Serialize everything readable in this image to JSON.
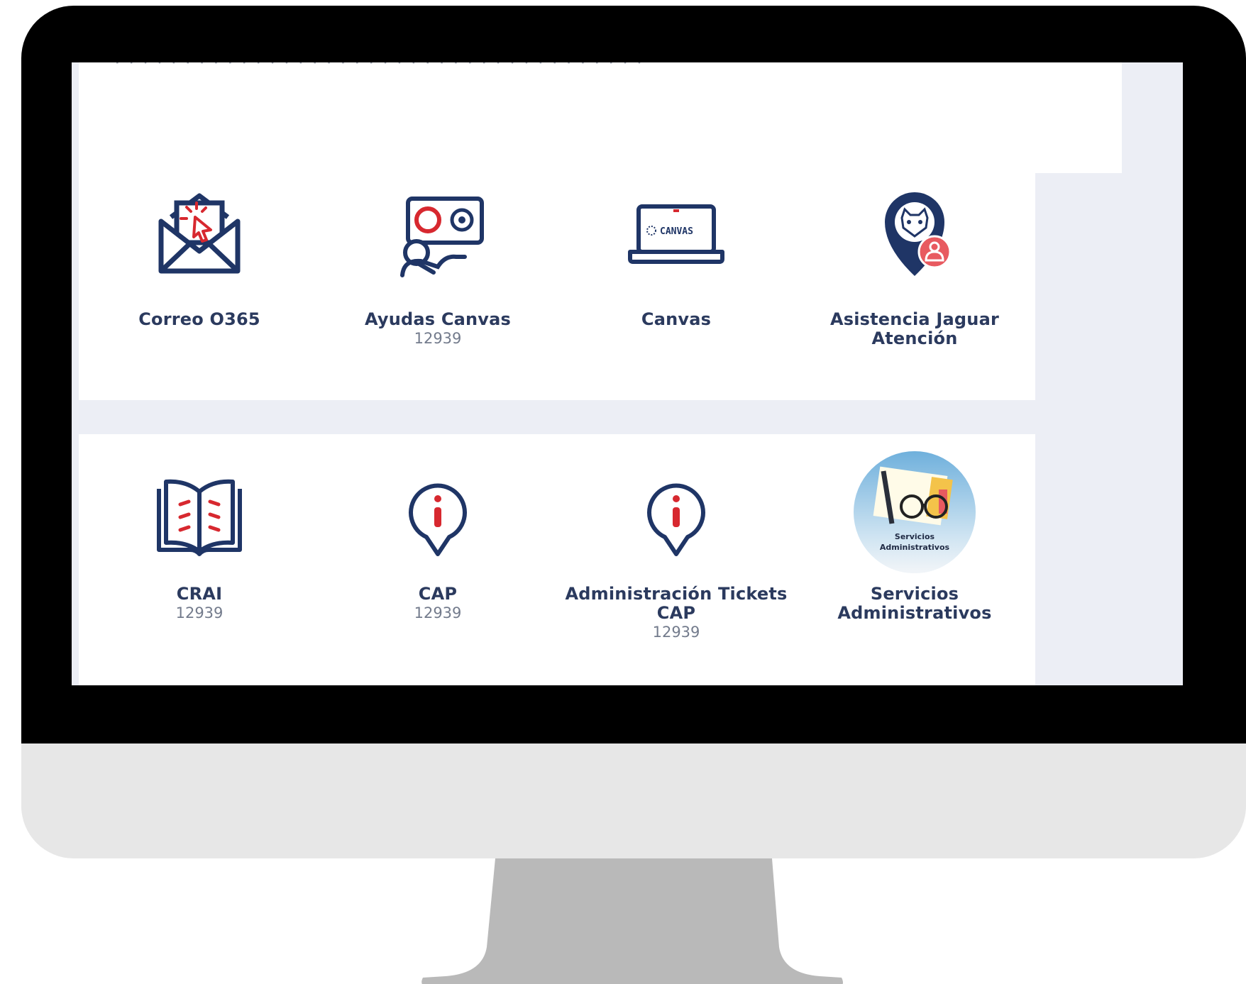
{
  "intro": {
    "text": "· · · · · · · · · · · · · · · · · · · · · · · · · · · · · · · · · · · · · ·"
  },
  "tiles": [
    {
      "name": "Correo O365",
      "code": "",
      "icon": "envelope-click-icon"
    },
    {
      "name": "Ayudas Canvas",
      "code": "12939",
      "icon": "canvas-help-presenter-icon"
    },
    {
      "name": "Canvas",
      "code": "",
      "icon": "laptop-canvas-icon",
      "icon_text": "CANVAS"
    },
    {
      "name": "Asistencia Jaguar",
      "name2": "Atención",
      "code": "",
      "icon": "jaguar-location-pin-icon"
    },
    {
      "name": "CRAI",
      "code": "12939",
      "icon": "open-book-icon"
    },
    {
      "name": "CAP",
      "code": "12939",
      "icon": "info-pin-icon"
    },
    {
      "name": "Administración Tickets",
      "name2": "CAP",
      "code": "12939",
      "icon": "info-pin-icon"
    },
    {
      "name": "Servicios",
      "name2": "Administrativos",
      "code": "",
      "icon": "admin-services-badge-icon",
      "badge_line1": "Servicios",
      "badge_line2": "Administrativos"
    }
  ],
  "colors": {
    "navy": "#1f3566",
    "red": "#d7282f",
    "text": "#2b3a5e",
    "muted": "#737b8c",
    "screen_bg": "#eceef5"
  }
}
